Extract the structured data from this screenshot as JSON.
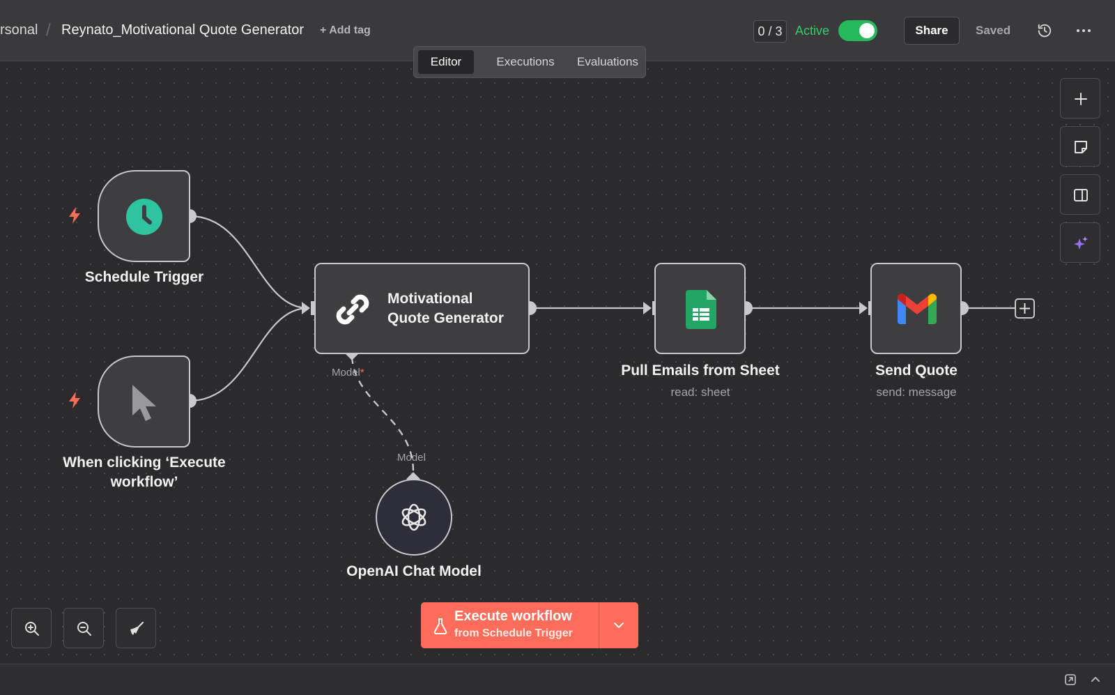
{
  "header": {
    "breadcrumb_parent": "rsonal",
    "breadcrumb_sep": "/",
    "workflow_name": "Reynato_Motivational Quote Generator",
    "add_tag": "+ Add tag",
    "counter": "0 / 3",
    "active_label": "Active",
    "active": true,
    "share": "Share",
    "saved": "Saved"
  },
  "tabs": [
    {
      "label": "Editor",
      "selected": true
    },
    {
      "label": "Executions",
      "selected": false
    },
    {
      "label": "Evaluations",
      "selected": false
    }
  ],
  "nodes": {
    "schedule": {
      "label": "Schedule Trigger",
      "icon": "clock-icon"
    },
    "manual": {
      "label_line1": "When clicking ‘Execute",
      "label_line2": "workflow’",
      "icon": "cursor-icon"
    },
    "agent": {
      "label_line1": "Motivational",
      "label_line2": "Quote Generator",
      "icon": "chain-link-icon",
      "port_label": "Model",
      "port_required": "*"
    },
    "sheet": {
      "label": "Pull Emails from Sheet",
      "sub": "read: sheet",
      "icon": "google-sheets-icon"
    },
    "gmail": {
      "label": "Send Quote",
      "sub": "send: message",
      "icon": "gmail-icon"
    },
    "openai": {
      "label": "OpenAI Chat Model",
      "port_label": "Model",
      "icon": "openai-icon"
    }
  },
  "execute": {
    "title": "Execute workflow",
    "subtitle": "from Schedule Trigger"
  },
  "colors": {
    "accent": "#ff6d5a",
    "active_green": "#25b95b",
    "clock_green": "#2fc4a0",
    "sheets_green": "#22a565",
    "sparkle_purple": "#9b6cf0"
  }
}
